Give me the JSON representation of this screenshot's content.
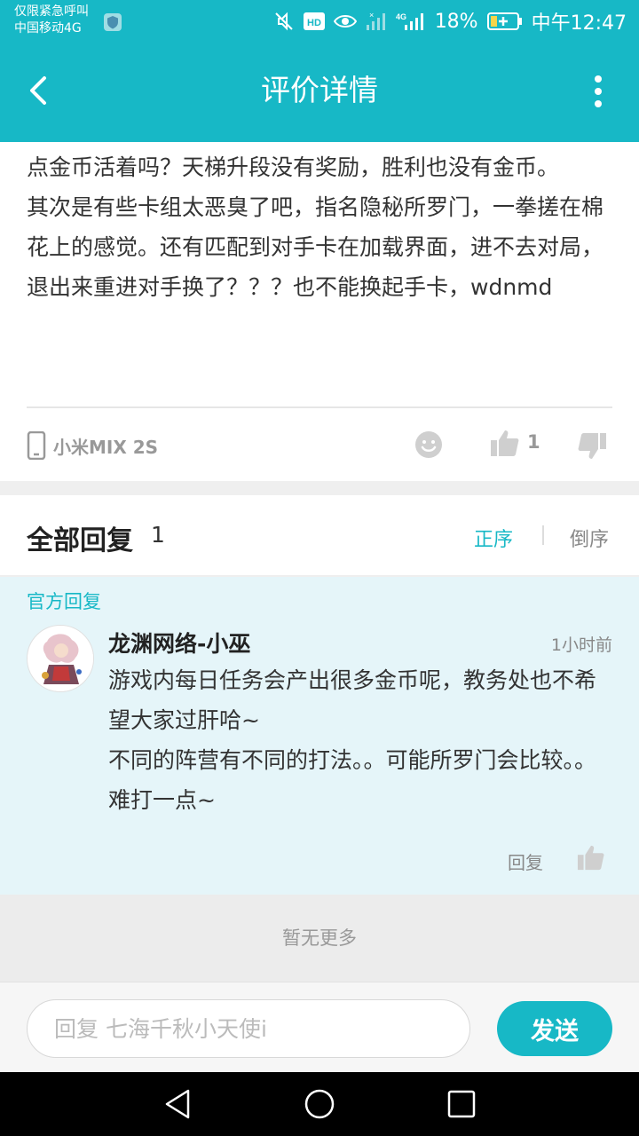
{
  "status_bar": {
    "line1": "仅限紧急呼叫",
    "line2": "中国移动4G",
    "battery": "18%",
    "time": "中午12:47",
    "icons": [
      "mute-icon",
      "hd-icon",
      "eye-icon",
      "signal-icon",
      "4g-signal-icon",
      "battery-icon"
    ]
  },
  "header": {
    "title": "评价详情",
    "back_icon": "back-arrow-icon",
    "more_icon": "more-vertical-icon"
  },
  "review": {
    "lines": [
      "点金币活着吗？天梯升段没有奖励，胜利也没有金币。",
      "其次是有些卡组太恶臭了吧，指名隐秘所罗门，一拳搓在棉花上的感觉。还有匹配到对手卡在加载界面，进不去对局，退出来重进对手换了？？？也不能换起手卡，wdnmd"
    ],
    "device": "小米MIX 2S",
    "like_count": "1"
  },
  "replies": {
    "label": "全部回复",
    "count": "1",
    "sort_asc": "正序",
    "sort_desc": "倒序"
  },
  "official_reply": {
    "tag": "官方回复",
    "author": "龙渊网络-小巫",
    "time": "1小时前",
    "lines": [
      "游戏内每日任务会产出很多金币呢，教务处也不希望大家过肝哈~",
      "不同的阵营有不同的打法。。可能所罗门会比较。。难打一点~"
    ],
    "reply_label": "回复"
  },
  "footer_note": "暂无更多",
  "input": {
    "placeholder": "回复 七海千秋小天使i",
    "send_label": "发送"
  },
  "colors": {
    "accent": "#17b8c6",
    "official_bg": "#e5f5f9"
  }
}
